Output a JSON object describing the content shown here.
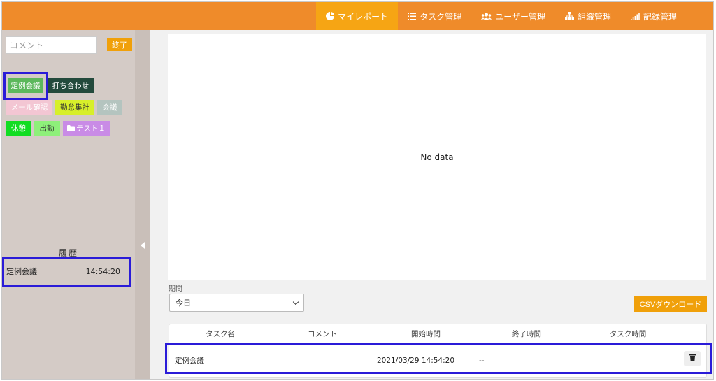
{
  "nav": {
    "items": [
      {
        "label": "マイレポート",
        "icon": "pie-chart-icon",
        "active": true
      },
      {
        "label": "タスク管理",
        "icon": "list-icon",
        "active": false
      },
      {
        "label": "ユーザー管理",
        "icon": "users-icon",
        "active": false
      },
      {
        "label": "組織管理",
        "icon": "org-chart-icon",
        "active": false
      },
      {
        "label": "記録管理",
        "icon": "bar-signal-icon",
        "active": false
      }
    ]
  },
  "sidebar": {
    "comment_placeholder": "コメント",
    "end_label": "終了",
    "tags": [
      {
        "label": "定例会議",
        "bg": "#5cb85c",
        "color": "#ffffff"
      },
      {
        "label": "打ち合わせ",
        "bg": "#234a3c",
        "color": "#ffffff"
      },
      {
        "label": "メール確認",
        "bg": "#f3c6d3",
        "color": "#ffffff"
      },
      {
        "label": "勤怠集計",
        "bg": "#d7ef2a",
        "color": "#333333"
      },
      {
        "label": "会議",
        "bg": "#b4c4bf",
        "color": "#ffffff"
      },
      {
        "label": "休憩",
        "bg": "#11dd22",
        "color": "#ffffff"
      },
      {
        "label": "出勤",
        "bg": "#8ef07a",
        "color": "#333333"
      },
      {
        "label": "テスト１",
        "bg": "#c98be6",
        "color": "#ffffff",
        "icon": "folder-icon"
      }
    ],
    "history_title": "履歴",
    "history": [
      {
        "task": "定例会議",
        "time": "14:54:20"
      }
    ]
  },
  "main": {
    "chart_empty_text": "No data",
    "period_label": "期間",
    "period_value": "今日",
    "csv_label": "CSVダウンロード",
    "table": {
      "headers": [
        "タスク名",
        "コメント",
        "開始時間",
        "終了時間",
        "タスク時間"
      ],
      "rows": [
        {
          "task": "定例会議",
          "comment": "",
          "start": "2021/03/29 14:54:20",
          "end": "--",
          "duration": ""
        }
      ]
    }
  },
  "colors": {
    "topbar": "#ef8b2a",
    "nav_active": "#f6a514",
    "accent_button": "#f0a00a",
    "highlight_box": "#2a1bd8",
    "sidebar_bg": "#d4cbc6"
  }
}
